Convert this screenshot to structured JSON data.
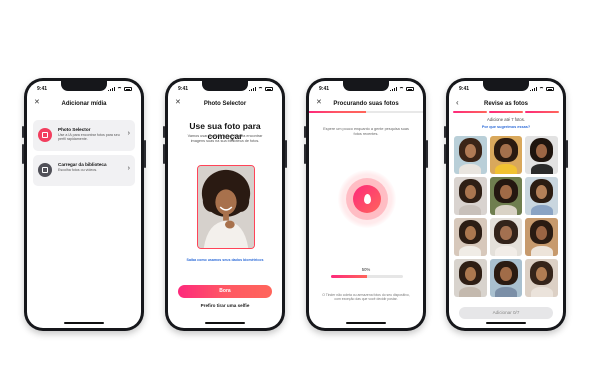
{
  "status_time": "9:41",
  "screens": [
    {
      "title": "Adicionar mídia",
      "options": [
        {
          "title": "Photo Selector",
          "description": "Use a IA para encontrar fotos para seu perfil rapidamente."
        },
        {
          "title": "Carregar da biblioteca",
          "description": "Escolha fotos ou vídeos."
        }
      ]
    },
    {
      "title": "Photo Selector",
      "heading": "Use sua foto para começar",
      "subtitle": "Vamos usar sua foto de perfil para encontrar imagens suas na sua biblioteca de fotos.",
      "link": "Saiba como usamos seus dados biométricos",
      "primary_button": "Bora",
      "secondary_button": "Prefiro tirar uma selfie"
    },
    {
      "title": "Procurando suas fotos",
      "message": "Espere um pouco enquanto a gente pesquisa suas fotos recentes.",
      "progress_label": "50%",
      "progress_value": 0.5,
      "footnote": "O Tinder não coleta ou armazena fotos do seu dispositivo, com exceção das que você decidir postar."
    },
    {
      "title": "Revise as fotos",
      "added_text": "Adicione até 7 fotos.",
      "why_link": "Por que sugerimos essas?",
      "button": "Adicionar 0/7",
      "photos": [
        {
          "bg": "#b9cfd8",
          "hair": "#3b2417",
          "skin": "#b07a55",
          "top": "#e9e5df"
        },
        {
          "bg": "#d9a85c",
          "hair": "#2a1a10",
          "skin": "#a4704c",
          "top": "#f1c232"
        },
        {
          "bg": "#e2e2e2",
          "hair": "#1e140e",
          "skin": "#9c6645",
          "top": "#2b2b2b"
        },
        {
          "bg": "#d9d3cf",
          "hair": "#2f1f15",
          "skin": "#a9754f",
          "top": "#c8c0ba"
        },
        {
          "bg": "#6f7e4f",
          "hair": "#241710",
          "skin": "#a06a46",
          "top": "#d9d2c5"
        },
        {
          "bg": "#c9d6df",
          "hair": "#2b1c12",
          "skin": "#b48058",
          "top": "#8aa3c3"
        },
        {
          "bg": "#d7c8bb",
          "hair": "#2c1d14",
          "skin": "#ab774f",
          "top": "#f0ece6"
        },
        {
          "bg": "#e4e0da",
          "hair": "#33231a",
          "skin": "#a37050",
          "top": "#f2ede8"
        },
        {
          "bg": "#c79a6d",
          "hair": "#2a1b12",
          "skin": "#9a6443",
          "top": "#ede4da"
        },
        {
          "bg": "#d8d3cd",
          "hair": "#2e1e14",
          "skin": "#ac784f",
          "top": "#c4b9ae"
        },
        {
          "bg": "#a9c0cf",
          "hair": "#2a1b12",
          "skin": "#a16c48",
          "top": "#7b8fa7"
        },
        {
          "bg": "#dcd0c5",
          "hair": "#35241a",
          "skin": "#b07c53",
          "top": "#ebe3db"
        }
      ]
    }
  ]
}
